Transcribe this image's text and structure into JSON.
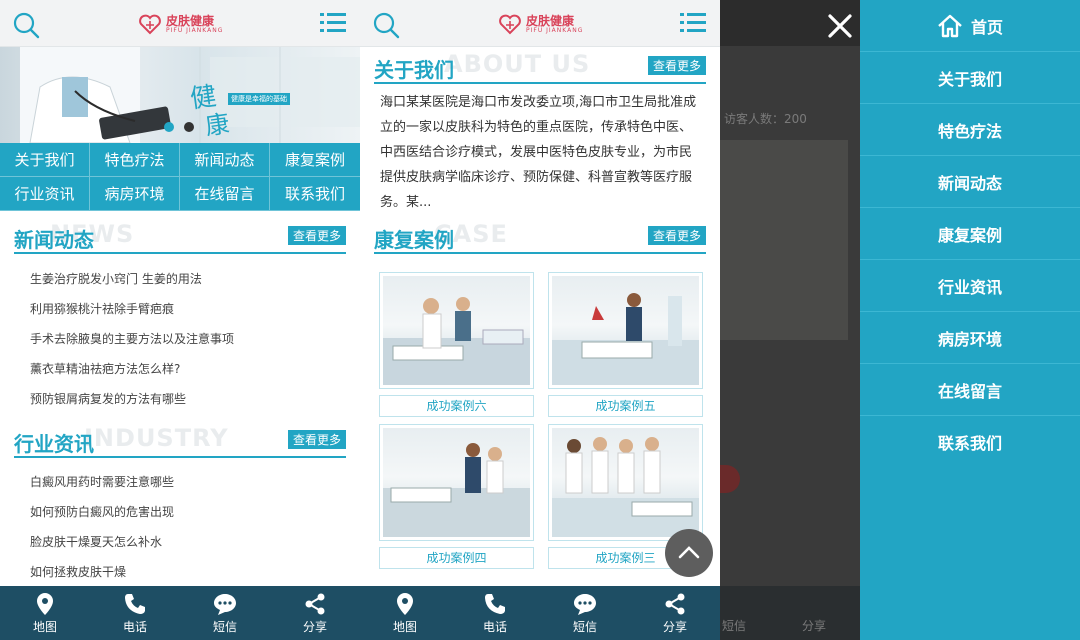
{
  "header": {
    "logo_text": "皮肤健康",
    "logo_sub": "PIFU JIANKANG"
  },
  "banner": {
    "calligraphy_1": "健",
    "calligraphy_2": "康",
    "tagline": "健康是幸福的基础"
  },
  "nav": [
    "关于我们",
    "特色疗法",
    "新闻动态",
    "康复案例",
    "行业资讯",
    "病房环境",
    "在线留言",
    "联系我们"
  ],
  "news_section": {
    "title": "新闻动态",
    "bg": "NEWS",
    "more": "查看更多",
    "items": [
      "生姜治疗脱发小窍门 生姜的用法",
      "利用猕猴桃汁祛除手臂疤痕",
      "手术去除腋臭的主要方法以及注意事项",
      "薰衣草精油祛疤方法怎么样?",
      "预防银屑病复发的方法有哪些"
    ]
  },
  "industry_section": {
    "title": "行业资讯",
    "bg": "INDUSTRY",
    "more": "查看更多",
    "items": [
      "白癜风用药时需要注意哪些",
      "如何预防白癜风的危害出现",
      "脸皮肤干燥夏天怎么补水",
      "如何拯救皮肤干燥"
    ]
  },
  "about_section": {
    "title": "关于我们",
    "bg": "ABOUT US",
    "more": "查看更多",
    "text": "海口某某医院是海口市发改委立项,海口市卫生局批准成立的一家以皮肤科为特色的重点医院，传承特色中医、中西医结合诊疗模式，发展中医特色皮肤专业，为市民提供皮肤病学临床诊疗、预防保健、科普宣教等医疗服务。某..."
  },
  "cases_section": {
    "title": "康复案例",
    "bg": "CASE",
    "more": "查看更多",
    "items": [
      "成功案例六",
      "成功案例五",
      "成功案例四",
      "成功案例三"
    ]
  },
  "bottom_bar": [
    "地图",
    "电话",
    "短信",
    "分享"
  ],
  "dim_panel": {
    "peek_text": "访客人数：200",
    "peek_label_1": "短信",
    "peek_label_2": "分享"
  },
  "side_menu": {
    "home": "首页",
    "items": [
      "关于我们",
      "特色疗法",
      "新闻动态",
      "康复案例",
      "行业资讯",
      "病房环境",
      "在线留言",
      "联系我们"
    ]
  },
  "colors": {
    "accent": "#22a5c4",
    "bottom_bar": "#1e4e64",
    "logo": "#d9435a"
  }
}
